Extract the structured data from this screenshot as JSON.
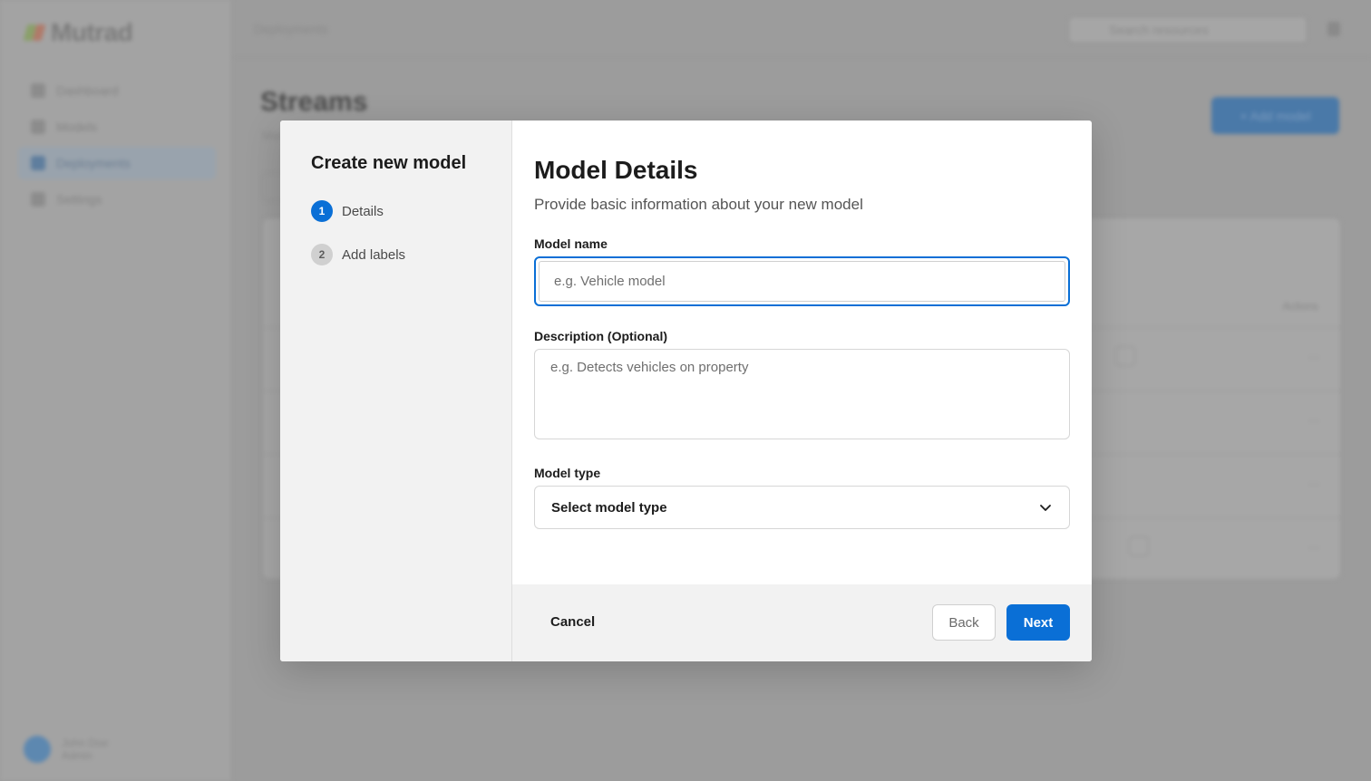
{
  "app": {
    "logo_text": "Mutrad",
    "breadcrumb": "Deployments",
    "search_placeholder": "Search resources",
    "nav": [
      {
        "label": "Dashboard",
        "icon": "home-icon"
      },
      {
        "label": "Models",
        "icon": "grid-icon"
      },
      {
        "label": "Deployments",
        "icon": "rocket-icon",
        "active": true
      },
      {
        "label": "Settings",
        "icon": "gear-icon"
      }
    ],
    "user": {
      "name": "John Doe",
      "role": "Admin"
    },
    "page_title": "Streams",
    "page_subtitle": "Manage your streams",
    "add_button_label": "+ Add model",
    "table_action_header": "Actions"
  },
  "modal": {
    "sidebar_title": "Create new model",
    "steps": [
      {
        "number": "1",
        "label": "Details",
        "state": "active"
      },
      {
        "number": "2",
        "label": "Add labels",
        "state": "inactive"
      }
    ],
    "title": "Model Details",
    "subtitle": "Provide basic information about your new model",
    "fields": {
      "name": {
        "label": "Model name",
        "placeholder": "e.g. Vehicle model",
        "value": ""
      },
      "description": {
        "label": "Description (Optional)",
        "placeholder": "e.g. Detects vehicles on property",
        "value": ""
      },
      "type": {
        "label": "Model type",
        "selected": "Select model type"
      }
    },
    "buttons": {
      "cancel": "Cancel",
      "back": "Back",
      "next": "Next"
    }
  },
  "colors": {
    "accent": "#0a6fd6",
    "overlay": "#9c9c9c",
    "pane_bg": "#f2f2f2"
  }
}
